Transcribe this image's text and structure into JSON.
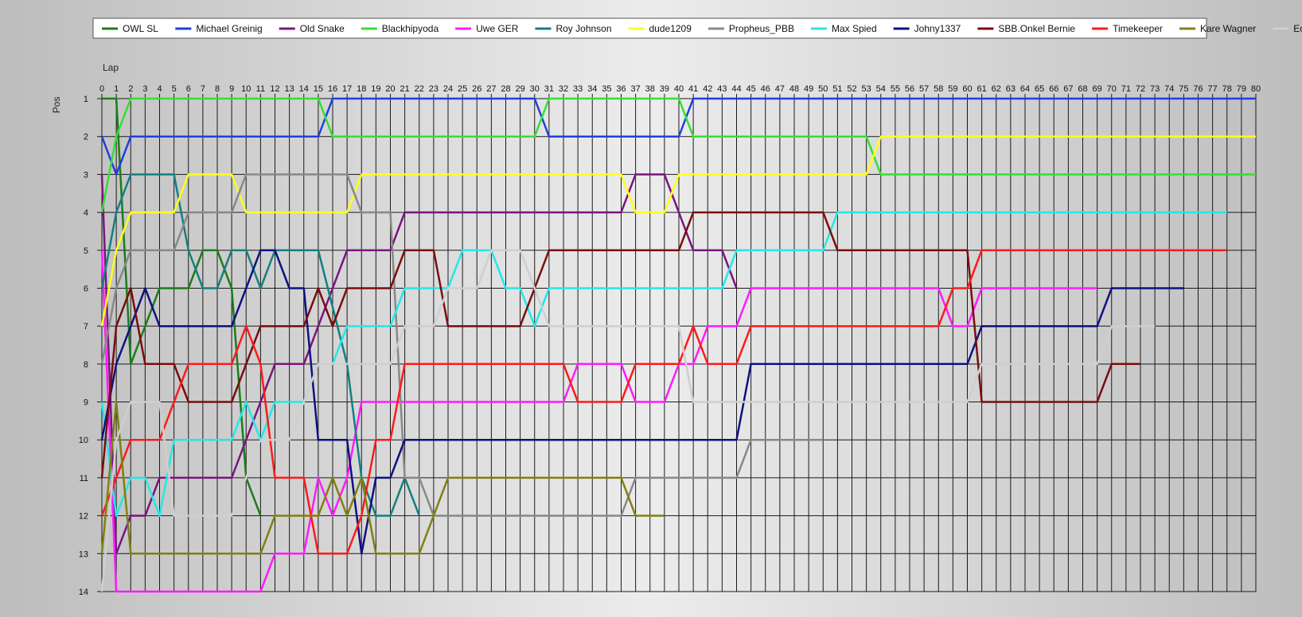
{
  "chart_data": {
    "type": "line",
    "title": "",
    "xlabel": "Lap",
    "ylabel": "Pos",
    "xlim": [
      0,
      80
    ],
    "ylim": [
      1,
      14
    ],
    "y_inverted": true,
    "grid": true,
    "legend_placement": "top",
    "x_ticks": [
      0,
      1,
      2,
      3,
      4,
      5,
      6,
      7,
      8,
      9,
      10,
      11,
      12,
      13,
      14,
      15,
      16,
      17,
      18,
      19,
      20,
      21,
      22,
      23,
      24,
      25,
      26,
      27,
      28,
      29,
      30,
      31,
      32,
      33,
      34,
      35,
      36,
      37,
      38,
      39,
      40,
      41,
      42,
      43,
      44,
      45,
      46,
      47,
      48,
      49,
      50,
      51,
      52,
      53,
      54,
      55,
      56,
      57,
      58,
      59,
      60,
      61,
      62,
      63,
      64,
      65,
      66,
      67,
      68,
      69,
      70,
      71,
      72,
      73,
      74,
      75,
      76,
      77,
      78,
      79,
      80
    ],
    "y_ticks": [
      1,
      2,
      3,
      4,
      5,
      6,
      7,
      8,
      9,
      10,
      11,
      12,
      13,
      14
    ],
    "series": [
      {
        "name": "OWL SL",
        "color": "#1a7d1a",
        "points": [
          [
            0,
            1
          ],
          [
            1,
            1
          ],
          [
            2,
            8
          ],
          [
            3,
            7
          ],
          [
            4,
            6
          ],
          [
            5,
            6
          ],
          [
            6,
            6
          ],
          [
            7,
            5
          ],
          [
            8,
            5
          ],
          [
            9,
            6
          ],
          [
            10,
            11
          ],
          [
            11,
            12
          ]
        ]
      },
      {
        "name": "Michael Greinig",
        "color": "#1f3fe0",
        "points": [
          [
            0,
            2
          ],
          [
            1,
            3
          ],
          [
            2,
            2
          ],
          [
            15,
            2
          ],
          [
            16,
            1
          ],
          [
            30,
            1
          ],
          [
            31,
            2
          ],
          [
            40,
            2
          ],
          [
            41,
            1
          ],
          [
            80,
            1
          ]
        ]
      },
      {
        "name": "Old Snake",
        "color": "#7a1480",
        "points": [
          [
            0,
            3
          ],
          [
            1,
            13
          ],
          [
            2,
            12
          ],
          [
            3,
            12
          ],
          [
            4,
            11
          ],
          [
            9,
            11
          ],
          [
            11,
            9
          ],
          [
            12,
            8
          ],
          [
            14,
            8
          ],
          [
            17,
            5
          ],
          [
            20,
            5
          ],
          [
            21,
            4
          ],
          [
            36,
            4
          ],
          [
            37,
            3
          ],
          [
            39,
            3
          ],
          [
            41,
            5
          ],
          [
            43,
            5
          ],
          [
            44,
            6
          ]
        ]
      },
      {
        "name": "Blackhipyoda",
        "color": "#33e033",
        "points": [
          [
            0,
            4
          ],
          [
            1,
            2
          ],
          [
            2,
            1
          ],
          [
            15,
            1
          ],
          [
            16,
            2
          ],
          [
            30,
            2
          ],
          [
            31,
            1
          ],
          [
            40,
            1
          ],
          [
            41,
            2
          ],
          [
            53,
            2
          ],
          [
            54,
            3
          ],
          [
            80,
            3
          ]
        ]
      },
      {
        "name": "Uwe GER",
        "color": "#ff1aff",
        "points": [
          [
            0,
            5
          ],
          [
            1,
            14
          ],
          [
            2,
            14
          ],
          [
            11,
            14
          ],
          [
            12,
            13
          ],
          [
            14,
            13
          ],
          [
            15,
            11
          ],
          [
            16,
            12
          ],
          [
            17,
            11
          ],
          [
            18,
            9
          ],
          [
            31,
            9
          ],
          [
            32,
            9
          ],
          [
            33,
            8
          ],
          [
            36,
            8
          ],
          [
            37,
            9
          ],
          [
            39,
            9
          ],
          [
            40,
            8
          ],
          [
            41,
            8
          ],
          [
            42,
            7
          ],
          [
            44,
            7
          ],
          [
            45,
            6
          ],
          [
            58,
            6
          ],
          [
            59,
            7
          ],
          [
            60,
            7
          ],
          [
            61,
            6
          ],
          [
            69,
            6
          ]
        ]
      },
      {
        "name": "Roy Johnson",
        "color": "#138080",
        "points": [
          [
            0,
            6
          ],
          [
            1,
            4
          ],
          [
            2,
            3
          ],
          [
            5,
            3
          ],
          [
            6,
            5
          ],
          [
            7,
            6
          ],
          [
            8,
            6
          ],
          [
            9,
            5
          ],
          [
            10,
            5
          ],
          [
            11,
            6
          ],
          [
            12,
            5
          ],
          [
            15,
            5
          ],
          [
            17,
            8
          ],
          [
            18,
            11
          ],
          [
            19,
            12
          ],
          [
            20,
            12
          ],
          [
            21,
            11
          ],
          [
            22,
            12
          ]
        ]
      },
      {
        "name": "dude1209",
        "color": "#ffff1a",
        "points": [
          [
            0,
            7
          ],
          [
            1,
            5
          ],
          [
            2,
            4
          ],
          [
            5,
            4
          ],
          [
            6,
            3
          ],
          [
            9,
            3
          ],
          [
            10,
            4
          ],
          [
            17,
            4
          ],
          [
            18,
            3
          ],
          [
            36,
            3
          ],
          [
            37,
            4
          ],
          [
            39,
            4
          ],
          [
            40,
            3
          ],
          [
            53,
            3
          ],
          [
            54,
            2
          ],
          [
            80,
            2
          ]
        ]
      },
      {
        "name": "Propheus_PBB",
        "color": "#888888",
        "points": [
          [
            0,
            8
          ],
          [
            1,
            6
          ],
          [
            2,
            5
          ],
          [
            5,
            5
          ],
          [
            6,
            4
          ],
          [
            9,
            4
          ],
          [
            10,
            3
          ],
          [
            17,
            3
          ],
          [
            18,
            4
          ],
          [
            20,
            4
          ],
          [
            21,
            11
          ],
          [
            22,
            11
          ],
          [
            23,
            12
          ],
          [
            36,
            12
          ],
          [
            37,
            11
          ],
          [
            44,
            11
          ],
          [
            45,
            10
          ],
          [
            50,
            10
          ]
        ]
      },
      {
        "name": "Max Spied",
        "color": "#22e8e8",
        "points": [
          [
            0,
            9
          ],
          [
            1,
            12
          ],
          [
            2,
            11
          ],
          [
            3,
            11
          ],
          [
            4,
            12
          ],
          [
            5,
            10
          ],
          [
            9,
            10
          ],
          [
            10,
            9
          ],
          [
            11,
            10
          ],
          [
            12,
            9
          ],
          [
            14,
            9
          ],
          [
            15,
            8
          ],
          [
            16,
            8
          ],
          [
            17,
            7
          ],
          [
            20,
            7
          ],
          [
            21,
            6
          ],
          [
            24,
            6
          ],
          [
            25,
            5
          ],
          [
            27,
            5
          ],
          [
            28,
            6
          ],
          [
            29,
            6
          ],
          [
            30,
            7
          ],
          [
            31,
            6
          ],
          [
            43,
            6
          ],
          [
            44,
            5
          ],
          [
            50,
            5
          ],
          [
            51,
            4
          ],
          [
            78,
            4
          ]
        ]
      },
      {
        "name": "Johny1337",
        "color": "#101080",
        "points": [
          [
            0,
            10
          ],
          [
            1,
            8
          ],
          [
            2,
            7
          ],
          [
            3,
            6
          ],
          [
            4,
            7
          ],
          [
            9,
            7
          ],
          [
            11,
            5
          ],
          [
            12,
            5
          ],
          [
            13,
            6
          ],
          [
            14,
            6
          ],
          [
            15,
            10
          ],
          [
            17,
            10
          ],
          [
            18,
            13
          ],
          [
            19,
            11
          ],
          [
            20,
            11
          ],
          [
            21,
            10
          ],
          [
            44,
            10
          ],
          [
            45,
            8
          ],
          [
            60,
            8
          ],
          [
            61,
            7
          ],
          [
            69,
            7
          ],
          [
            70,
            6
          ],
          [
            75,
            6
          ]
        ]
      },
      {
        "name": "SBB.Onkel Bernie",
        "color": "#7a0d0d",
        "points": [
          [
            0,
            11
          ],
          [
            1,
            7
          ],
          [
            2,
            6
          ],
          [
            3,
            8
          ],
          [
            5,
            8
          ],
          [
            6,
            9
          ],
          [
            9,
            9
          ],
          [
            10,
            8
          ],
          [
            11,
            7
          ],
          [
            14,
            7
          ],
          [
            15,
            6
          ],
          [
            16,
            7
          ],
          [
            17,
            6
          ],
          [
            20,
            6
          ],
          [
            21,
            5
          ],
          [
            23,
            5
          ],
          [
            24,
            7
          ],
          [
            29,
            7
          ],
          [
            31,
            5
          ],
          [
            40,
            5
          ],
          [
            41,
            4
          ],
          [
            50,
            4
          ],
          [
            51,
            5
          ],
          [
            60,
            5
          ],
          [
            61,
            9
          ],
          [
            69,
            9
          ],
          [
            70,
            8
          ],
          [
            72,
            8
          ]
        ]
      },
      {
        "name": "Timekeeper",
        "color": "#ff1a1a",
        "points": [
          [
            0,
            12
          ],
          [
            1,
            11
          ],
          [
            2,
            10
          ],
          [
            4,
            10
          ],
          [
            6,
            8
          ],
          [
            9,
            8
          ],
          [
            10,
            7
          ],
          [
            11,
            8
          ],
          [
            12,
            11
          ],
          [
            14,
            11
          ],
          [
            15,
            13
          ],
          [
            17,
            13
          ],
          [
            18,
            12
          ],
          [
            19,
            10
          ],
          [
            20,
            10
          ],
          [
            21,
            8
          ],
          [
            32,
            8
          ],
          [
            33,
            9
          ],
          [
            36,
            9
          ],
          [
            37,
            8
          ],
          [
            40,
            8
          ],
          [
            41,
            7
          ],
          [
            42,
            8
          ],
          [
            44,
            8
          ],
          [
            45,
            7
          ],
          [
            58,
            7
          ],
          [
            59,
            6
          ],
          [
            60,
            6
          ],
          [
            61,
            5
          ],
          [
            78,
            5
          ]
        ]
      },
      {
        "name": "Kare Wagner",
        "color": "#808010",
        "points": [
          [
            0,
            13
          ],
          [
            1,
            9
          ],
          [
            2,
            13
          ],
          [
            11,
            13
          ],
          [
            12,
            12
          ],
          [
            15,
            12
          ],
          [
            16,
            11
          ],
          [
            17,
            12
          ],
          [
            18,
            11
          ],
          [
            19,
            13
          ],
          [
            22,
            13
          ],
          [
            23,
            12
          ],
          [
            24,
            11
          ],
          [
            36,
            11
          ],
          [
            37,
            12
          ],
          [
            39,
            12
          ]
        ]
      },
      {
        "name": "Ecky",
        "color": "#cfcfcf",
        "points": [
          [
            0,
            14
          ],
          [
            1,
            10
          ],
          [
            2,
            9
          ],
          [
            4,
            9
          ],
          [
            5,
            12
          ],
          [
            9,
            12
          ],
          [
            11,
            10
          ],
          [
            13,
            10
          ],
          [
            14,
            9
          ],
          [
            15,
            8
          ],
          [
            18,
            8
          ],
          [
            20,
            8
          ],
          [
            21,
            7
          ],
          [
            23,
            7
          ],
          [
            24,
            6
          ],
          [
            25,
            6
          ],
          [
            26,
            6
          ],
          [
            27,
            5
          ],
          [
            29,
            5
          ],
          [
            31,
            7
          ],
          [
            40,
            7
          ],
          [
            41,
            9
          ],
          [
            60,
            9
          ],
          [
            61,
            8
          ],
          [
            69,
            8
          ],
          [
            70,
            7
          ],
          [
            73,
            7
          ]
        ]
      }
    ]
  }
}
